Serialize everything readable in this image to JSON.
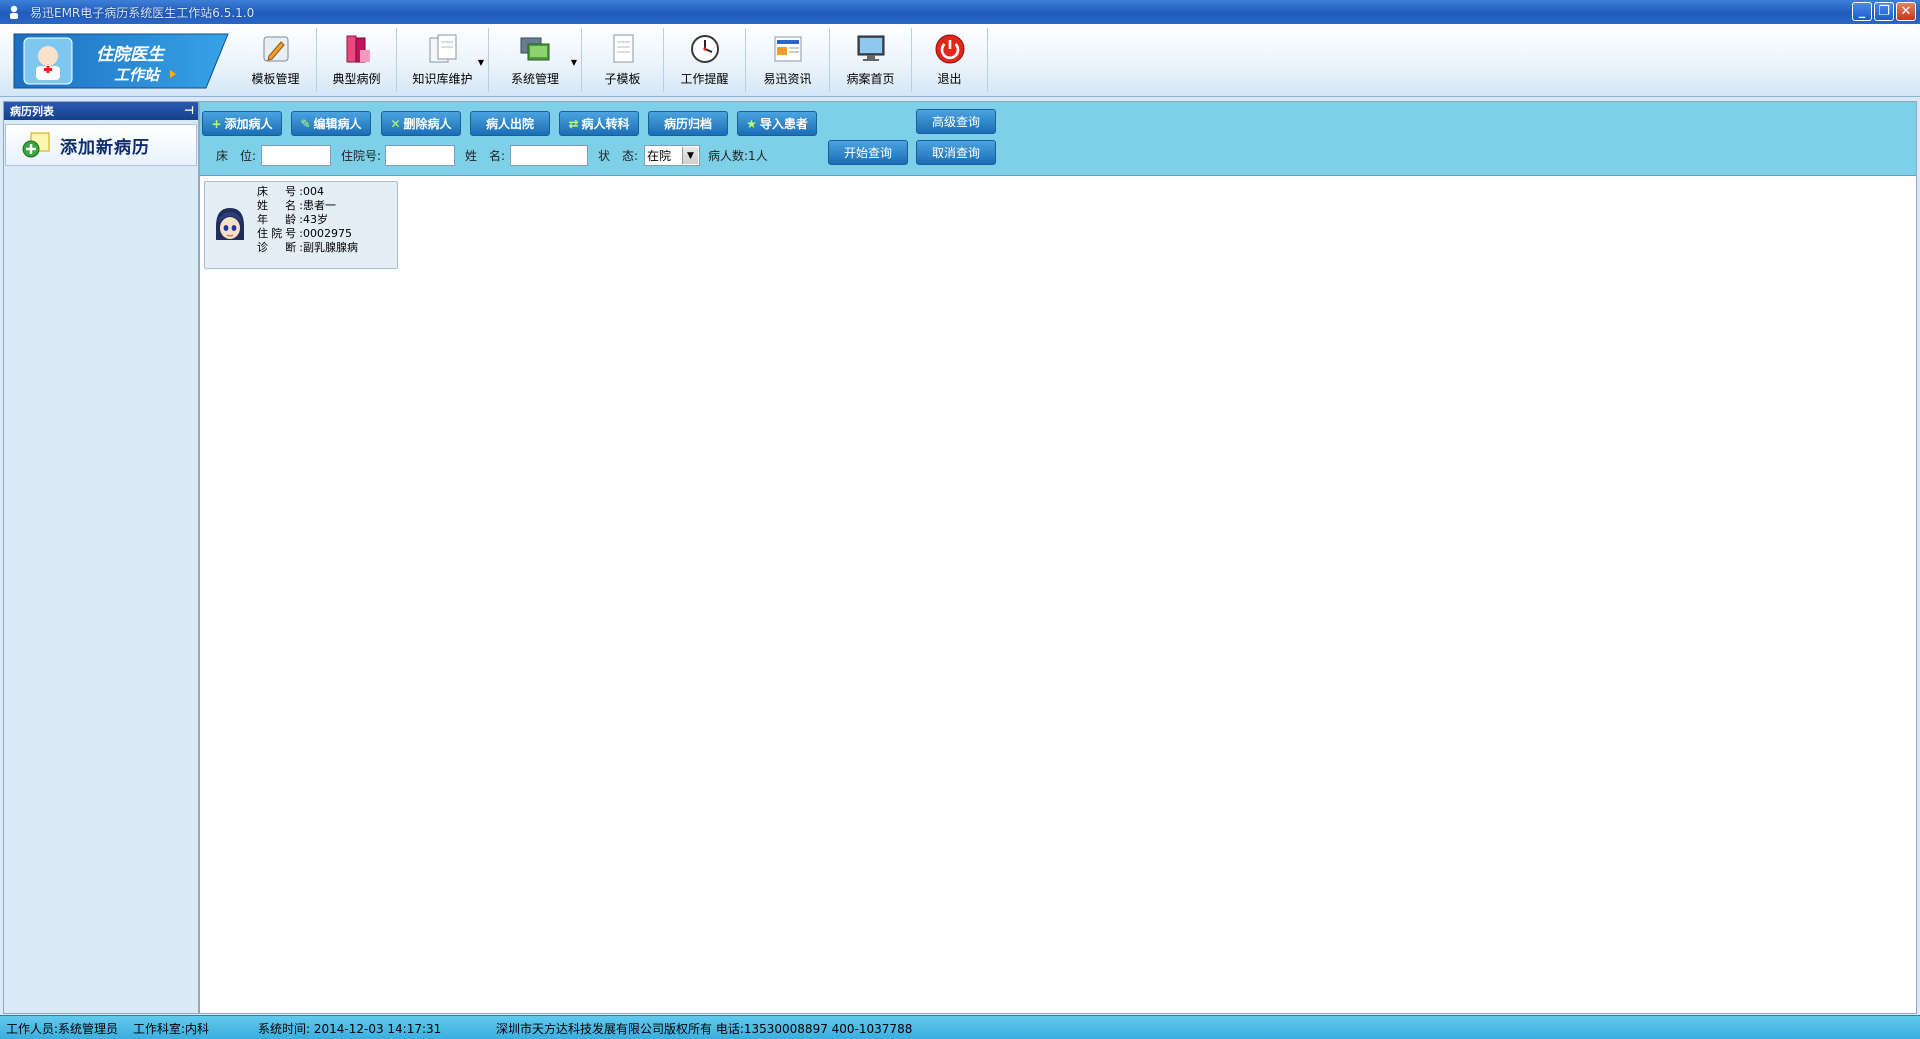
{
  "window": {
    "title": "易迅EMR电子病历系统医生工作站6.5.1.0"
  },
  "logo": {
    "line1": "住院医生",
    "line2": "工作站"
  },
  "toolbar": {
    "items": [
      {
        "label": "模板管理",
        "icon": "edit-template-icon"
      },
      {
        "label": "典型病例",
        "icon": "books-icon"
      },
      {
        "label": "知识库维护",
        "icon": "documents-icon"
      },
      {
        "label": "系统管理",
        "icon": "monitors-icon"
      },
      {
        "label": "子模板",
        "icon": "document-icon"
      },
      {
        "label": "工作提醒",
        "icon": "clock-icon"
      },
      {
        "label": "易迅资讯",
        "icon": "news-icon"
      },
      {
        "label": "病案首页",
        "icon": "computer-icon"
      },
      {
        "label": "退出",
        "icon": "power-icon"
      }
    ]
  },
  "left_panel": {
    "title": "病历列表",
    "add_label": "添加新病历"
  },
  "query": {
    "buttons": {
      "add_patient": "添加病人",
      "edit_patient": "编辑病人",
      "delete_patient": "删除病人",
      "discharge": "病人出院",
      "transfer": "病人转科",
      "archive": "病历归档",
      "import": "导入患者",
      "advanced": "高级查询",
      "start": "开始查询",
      "cancel": "取消查询"
    },
    "labels": {
      "bed": "床　位:",
      "admission_no": "住院号:",
      "name": "姓　名:",
      "status": "状　态:"
    },
    "values": {
      "bed": "",
      "admission_no": "",
      "name": "",
      "status": "在院"
    },
    "patient_count": "病人数:1人"
  },
  "patients": [
    {
      "bed_label": "床　号:",
      "bed": "004",
      "name_label": "姓　名:",
      "name": "患者一",
      "age_label": "年　龄:",
      "age": "43岁",
      "admission_label": "住院号:",
      "admission_no": "0002975",
      "diag_label": "诊　断:",
      "diagnosis": "副乳腺腺病"
    }
  ],
  "status_bar": {
    "staff": "工作人员:系统管理员",
    "department": "工作科室:内科",
    "time": "系统时间: 2014-12-03 14:17:31",
    "copyright": "深圳市天方达科技发展有限公司版权所有 电话:13530008897  400-1037788"
  }
}
